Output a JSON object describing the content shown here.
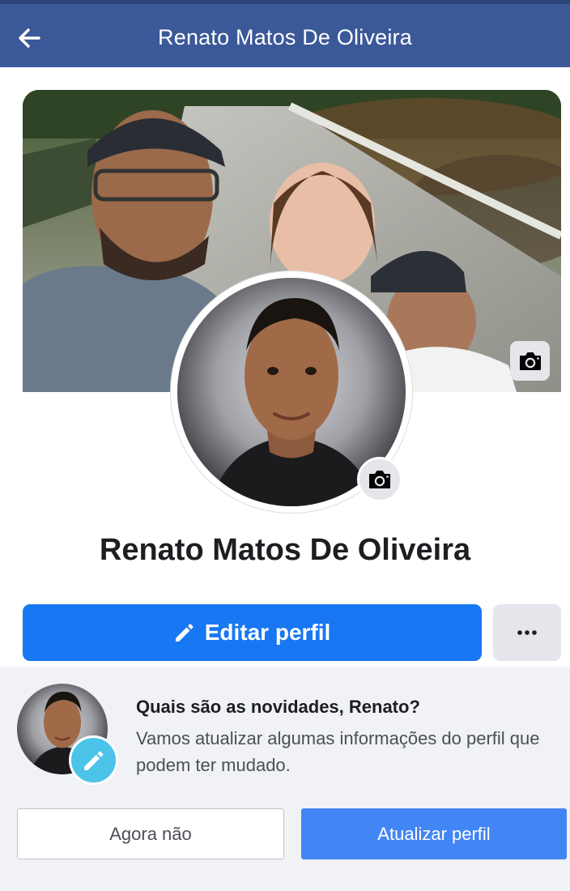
{
  "header": {
    "title": "Renato Matos De Oliveira",
    "back_icon": "arrow-left-icon"
  },
  "cover": {
    "camera_icon": "camera-icon"
  },
  "profile": {
    "name": "Renato Matos De Oliveira",
    "camera_icon": "camera-icon"
  },
  "actions": {
    "edit_label": "Editar perfil",
    "edit_icon": "pencil-icon",
    "more_icon": "more-dots-icon"
  },
  "update_prompt": {
    "title": "Quais são as novidades, Renato?",
    "description": "Vamos atualizar algumas informações do perfil que podem ter mudado.",
    "later_label": "Agora não",
    "update_label": "Atualizar perfil",
    "badge_icon": "pencil-icon"
  },
  "colors": {
    "header_bg": "#3b5998",
    "primary_blue": "#1877f2",
    "update_button": "#4285f4",
    "badge": "#4cc4ea",
    "card_bg": "#f0f2f5"
  }
}
